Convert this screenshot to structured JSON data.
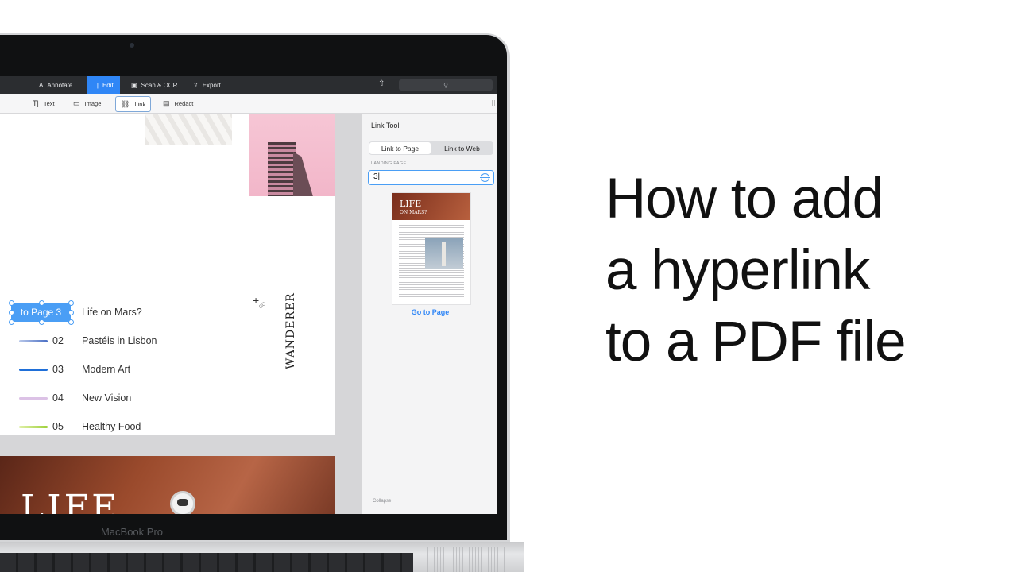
{
  "headline": {
    "line1": "How to add",
    "line2": "a hyperlink",
    "line3": "to a PDF file"
  },
  "device": {
    "brand": "MacBook Pro"
  },
  "app": {
    "tabs": [
      {
        "label": "Annotate",
        "icon": "annotate-icon",
        "glyph": "A"
      },
      {
        "label": "Edit",
        "icon": "edit-text-icon",
        "glyph": "T|",
        "active": true
      },
      {
        "label": "Scan & OCR",
        "icon": "scan-icon",
        "glyph": "▣"
      },
      {
        "label": "Export",
        "icon": "export-icon",
        "glyph": "⇪"
      }
    ],
    "tools": [
      {
        "label": "Text",
        "icon": "text-tool-icon",
        "glyph": "T|"
      },
      {
        "label": "Image",
        "icon": "image-tool-icon",
        "glyph": "▭"
      },
      {
        "label": "Link",
        "icon": "link-tool-icon",
        "glyph": "⛓",
        "selected": true
      },
      {
        "label": "Redact",
        "icon": "redact-tool-icon",
        "glyph": "▤"
      }
    ],
    "share_icon": "share-icon",
    "search_icon": "search-icon"
  },
  "document": {
    "link_label": "to Page 3",
    "toc": [
      {
        "number": "",
        "title": "Life on Mars?",
        "color": ""
      },
      {
        "number": "02",
        "title": "Pastéis in Lisbon",
        "color": "#6a8fd0"
      },
      {
        "number": "03",
        "title": "Modern Art",
        "color": "#1f6fd8"
      },
      {
        "number": "04",
        "title": "New Vision",
        "color": "#dcc2e6"
      },
      {
        "number": "05",
        "title": "Healthy Food",
        "color": "#b5dd5a"
      }
    ],
    "vertical_text": "WANDERER",
    "cursor_tag": "GO",
    "next_page_title": "LIFE"
  },
  "panel": {
    "title": "Link Tool",
    "segments": {
      "page": "Link to Page",
      "web": "Link to Web"
    },
    "landing_label": "LANDING PAGE",
    "landing_value": "3|",
    "thumb_title": "LIFE",
    "thumb_sub": "ON MARS?",
    "goto": "Go to Page",
    "collapse": "Collapse"
  },
  "colors": {
    "accent": "#2f86f6"
  }
}
